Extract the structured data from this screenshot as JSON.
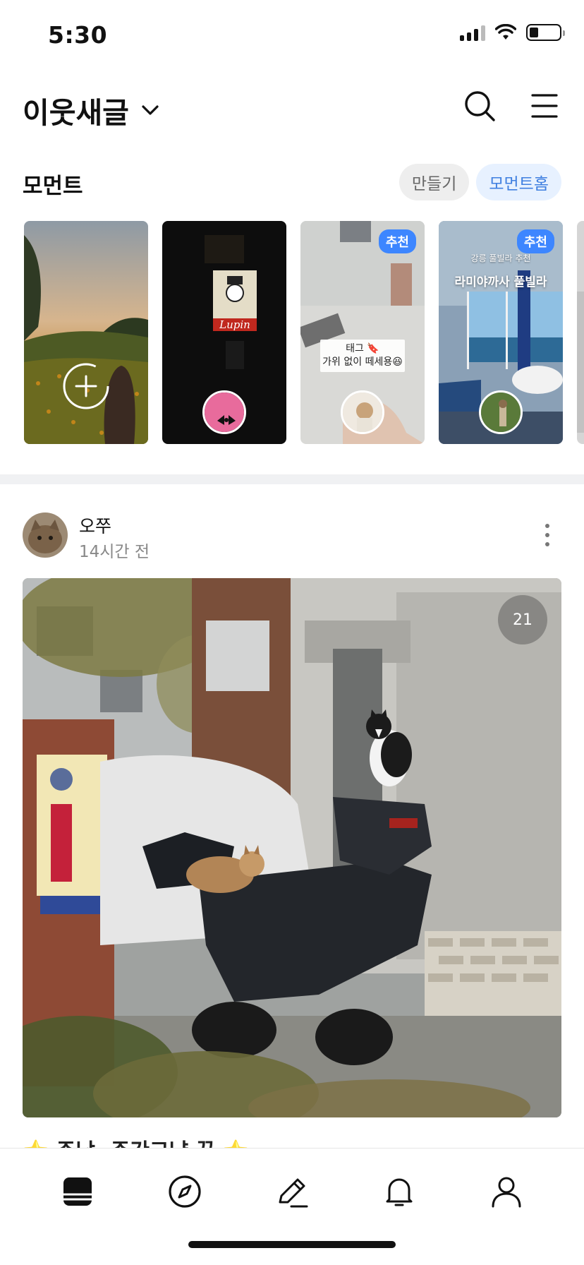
{
  "status_bar": {
    "time": "5:30",
    "battery_level": 0.3
  },
  "header": {
    "title": "이웃새글",
    "search_icon": "search-icon",
    "menu_icon": "menu-icon"
  },
  "moment": {
    "title": "모먼트",
    "create_label": "만들기",
    "home_label": "모먼트홈",
    "cards": [
      {
        "kind": "create",
        "icon": "plus-icon"
      },
      {
        "kind": "moment",
        "sign_text": "Lupin"
      },
      {
        "kind": "moment",
        "badge": "추천",
        "sticker_line1": "태그 🔖",
        "sticker_line2": "가위 없이 떼세용😆"
      },
      {
        "kind": "moment",
        "badge": "추천",
        "caption_small": "강릉 풀빌라 추천",
        "caption_big": "라미야까사 풀빌라"
      }
    ]
  },
  "post": {
    "author": "오쭈",
    "time": "14시간 전",
    "photo_count": "21",
    "title": "⭐ 주남, 주간고냥 끝 ⭐"
  },
  "tabbar": {
    "items": [
      {
        "name": "tab-home",
        "icon": "feed-icon",
        "active": true
      },
      {
        "name": "tab-explore",
        "icon": "compass-icon",
        "active": false
      },
      {
        "name": "tab-write",
        "icon": "pencil-icon",
        "active": false
      },
      {
        "name": "tab-notifications",
        "icon": "bell-icon",
        "active": false
      },
      {
        "name": "tab-profile",
        "icon": "person-icon",
        "active": false
      }
    ]
  },
  "colors": {
    "accent": "#3f7fe0",
    "badge": "#3d86ff",
    "divider": "#f0f1f3"
  }
}
